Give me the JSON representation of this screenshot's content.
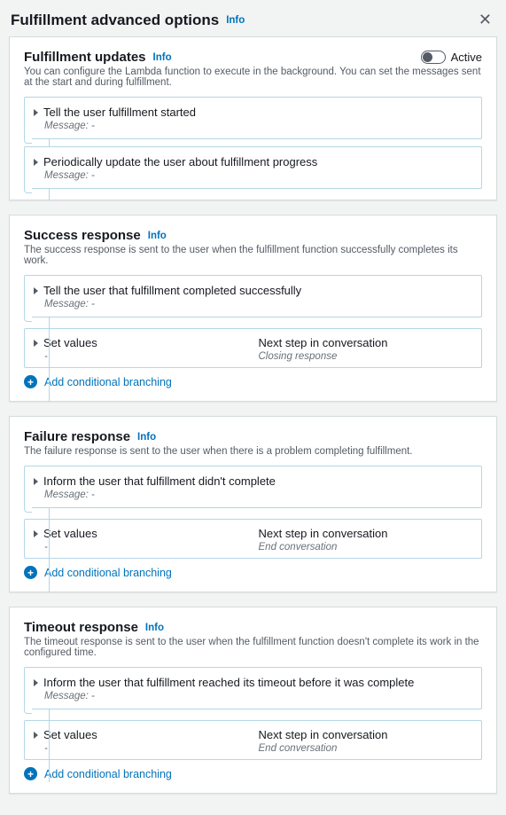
{
  "header": {
    "title": "Fulfillment advanced options",
    "info": "Info"
  },
  "toggle_label": "Active",
  "info": "Info",
  "add_branch": "Add conditional branching",
  "updates": {
    "title": "Fulfillment updates",
    "desc": "You can configure the Lambda function to execute in the background. You can set the messages sent at the start and during fulfillment.",
    "start_title": "Tell the user fulfillment started",
    "start_msg": "Message: -",
    "progress_title": "Periodically update the user about fulfillment progress",
    "progress_msg": "Message: -"
  },
  "success": {
    "title": "Success response",
    "desc": "The success response is sent to the user when the fulfillment function successfully completes its work.",
    "tell_title": "Tell the user that fulfillment completed successfully",
    "tell_msg": "Message: -",
    "set_values": "Set values",
    "set_values_sub": "-",
    "next_step": "Next step in conversation",
    "next_step_sub": "Closing response"
  },
  "failure": {
    "title": "Failure response",
    "desc": "The failure response is sent to the user when there is a problem completing fulfillment.",
    "tell_title": "Inform the user that fulfillment didn't complete",
    "tell_msg": "Message: -",
    "set_values": "Set values",
    "set_values_sub": "-",
    "next_step": "Next step in conversation",
    "next_step_sub": "End conversation"
  },
  "timeout": {
    "title": "Timeout response",
    "desc": "The timeout response is sent to the user when the fulfillment function doesn't complete its work in the configured time.",
    "tell_title": "Inform the user that fulfillment reached its timeout before it was complete",
    "tell_msg": "Message: -",
    "set_values": "Set values",
    "set_values_sub": "-",
    "next_step": "Next step in conversation",
    "next_step_sub": "End conversation"
  }
}
